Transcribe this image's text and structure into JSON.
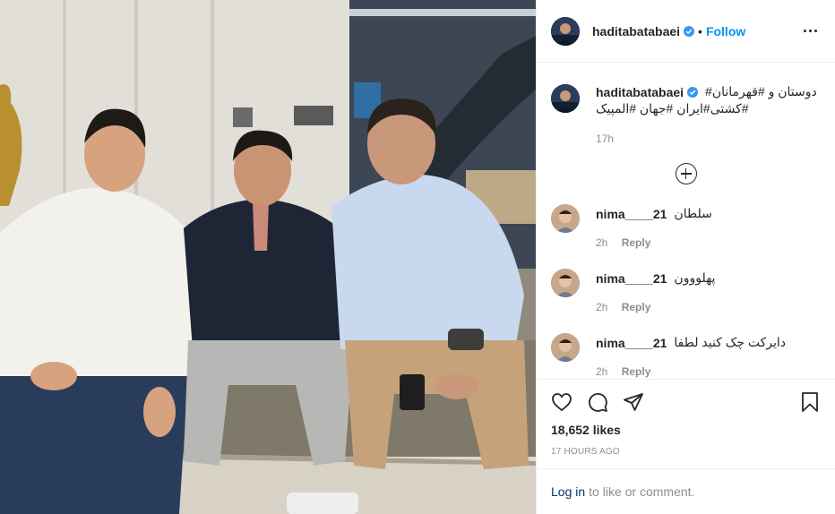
{
  "post": {
    "username": "haditabatabaei",
    "follow_label": "Follow",
    "separator": "•",
    "caption_line1": "دوستان و #قهرمانان#",
    "caption_line2": "#کشتی#ایران #جهان #المپیک",
    "caption_time": "17h"
  },
  "comments": [
    {
      "user": "nima____21",
      "text": "سلطان",
      "time": "2h",
      "reply_label": "Reply"
    },
    {
      "user": "nima____21",
      "text": "پهلووون",
      "time": "2h",
      "reply_label": "Reply"
    },
    {
      "user": "nima____21",
      "text": "دایرکت چک کنید لطفا",
      "time": "2h",
      "reply_label": "Reply"
    }
  ],
  "stats": {
    "likes": "18,652 likes",
    "posted_ago": "17 HOURS AGO"
  },
  "login": {
    "link_label": "Log in",
    "text": "to like or comment."
  },
  "icons": {
    "verified": "verified-badge-icon",
    "more": "more-options-icon",
    "load_more": "load-more-comments-icon",
    "like": "heart-icon",
    "comment": "comment-icon",
    "share": "share-icon",
    "save": "bookmark-icon"
  },
  "colors": {
    "follow": "#0095f6",
    "verified": "#3897f0",
    "muted": "#8e8e8e",
    "login_link": "#00376b"
  }
}
